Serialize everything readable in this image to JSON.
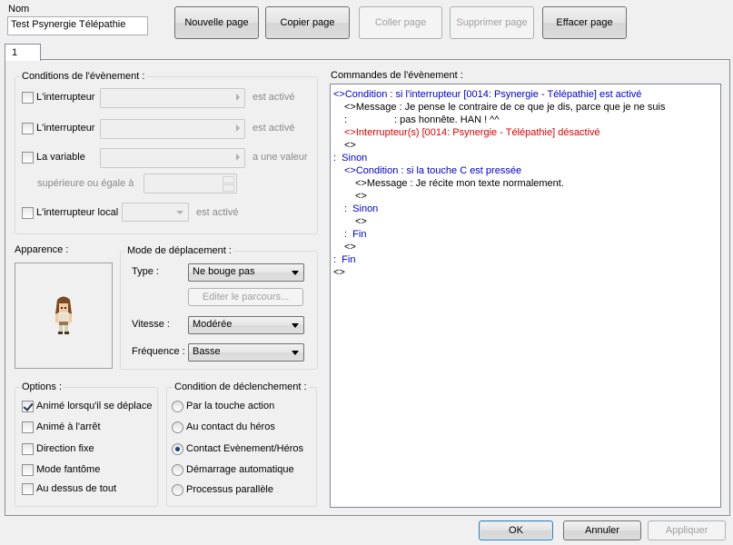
{
  "header": {
    "name_label": "Nom",
    "name_value": "Test Psynergie Télépathie"
  },
  "toolbar": {
    "new_page": "Nouvelle page",
    "copy_page": "Copier page",
    "paste_page": "Coller page",
    "delete_page": "Supprimer page",
    "clear_page": "Effacer page"
  },
  "tabs": [
    "1"
  ],
  "conditions": {
    "title": "Conditions de l'évènement :",
    "switch1_label": "L'interrupteur",
    "switch1_suffix": "est activé",
    "switch2_label": "L'interrupteur",
    "switch2_suffix": "est activé",
    "variable_label": "La variable",
    "variable_suffix": "a une valeur",
    "variable_compare": "supérieure ou égale à",
    "local_label": "L'interrupteur local",
    "local_suffix": "est activé"
  },
  "appearance": {
    "title": "Apparence :"
  },
  "movement": {
    "title": "Mode de déplacement :",
    "type_label": "Type :",
    "type_value": "Ne bouge pas",
    "route_button": "Editer le parcours...",
    "speed_label": "Vitesse :",
    "speed_value": "Modérée",
    "freq_label": "Fréquence :",
    "freq_value": "Basse"
  },
  "options": {
    "title": "Options :",
    "items": [
      {
        "label": "Animé lorsqu'il se déplace",
        "checked": true
      },
      {
        "label": "Animé à l'arrêt",
        "checked": false
      },
      {
        "label": "Direction fixe",
        "checked": false
      },
      {
        "label": "Mode fantôme",
        "checked": false
      },
      {
        "label": "Au dessus de tout",
        "checked": false
      }
    ]
  },
  "trigger": {
    "title": "Condition de déclenchement :",
    "items": [
      {
        "label": "Par la touche action",
        "selected": false
      },
      {
        "label": "Au contact du héros",
        "selected": false
      },
      {
        "label": "Contact Evènement/Héros",
        "selected": true
      },
      {
        "label": "Démarrage automatique",
        "selected": false
      },
      {
        "label": "Processus parallèle",
        "selected": false
      }
    ]
  },
  "commands": {
    "title": "Commandes de l'évènement :",
    "lines": [
      {
        "text": "<>Condition : si l'interrupteur [0014: Psynergie - Télépathie] est activé",
        "color": "blue",
        "indent": 0
      },
      {
        "text": "<>Message : Je pense le contraire de ce que je dis, parce que je ne suis",
        "color": "black",
        "indent": 1
      },
      {
        "text": ":                 : pas honnête. HAN ! ^^",
        "color": "black",
        "indent": 1
      },
      {
        "text": "<>Interrupteur(s) [0014: Psynergie - Télépathie] désactivé",
        "color": "red",
        "indent": 1
      },
      {
        "text": "<>",
        "color": "black",
        "indent": 1
      },
      {
        "text": ":  Sinon",
        "color": "blue",
        "indent": 0
      },
      {
        "text": "<>Condition : si la touche C est pressée",
        "color": "blue",
        "indent": 1
      },
      {
        "text": "<>Message : Je récite mon texte normalement.",
        "color": "black",
        "indent": 2
      },
      {
        "text": "<>",
        "color": "black",
        "indent": 2
      },
      {
        "text": ":  Sinon",
        "color": "blue",
        "indent": 1
      },
      {
        "text": "<>",
        "color": "black",
        "indent": 2
      },
      {
        "text": ":  Fin",
        "color": "blue",
        "indent": 1
      },
      {
        "text": "<>",
        "color": "black",
        "indent": 1
      },
      {
        "text": ":  Fin",
        "color": "blue",
        "indent": 0
      },
      {
        "text": "<>",
        "color": "black",
        "indent": 0
      }
    ]
  },
  "footer": {
    "ok": "OK",
    "cancel": "Annuler",
    "apply": "Appliquer"
  },
  "colors": {
    "blue": "#0000c8",
    "red": "#e00000",
    "black": "#000000"
  }
}
